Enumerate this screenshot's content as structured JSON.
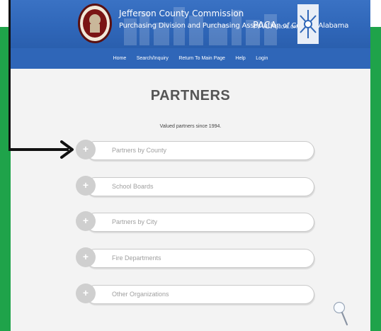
{
  "header": {
    "org_title": "Jefferson County Commission",
    "org_subtitle": "Purchasing Division and Purchasing Association of Central Alabama",
    "paca_main": "PACA",
    "paca_suffix": "JCCAL.ORG"
  },
  "nav": {
    "items": [
      "Home",
      "Search/Inquiry",
      "Return To Main Page",
      "Help",
      "Login"
    ]
  },
  "main": {
    "title": "PARTNERS",
    "subtitle": "Valued partners since 1994."
  },
  "accordion": {
    "items": [
      {
        "label": "Partners by County",
        "icon": "+"
      },
      {
        "label": "School Boards",
        "icon": "+"
      },
      {
        "label": "Partners by City",
        "icon": "+"
      },
      {
        "label": "Fire Departments",
        "icon": "+"
      },
      {
        "label": "Other Organizations",
        "icon": "+"
      }
    ]
  },
  "colors": {
    "banner_blue": "#2f66b8",
    "frame_green": "#1fa34a",
    "page_bg": "#f3f3f3"
  },
  "icons": {
    "arrow": "arrow-right-icon",
    "magnifier": "magnifier-icon"
  }
}
